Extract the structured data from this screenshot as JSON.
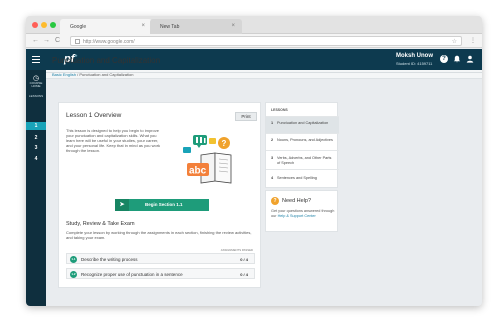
{
  "browser": {
    "tabs": [
      {
        "label": "Google",
        "close": "×"
      },
      {
        "label": "New Tab",
        "close": "×"
      }
    ],
    "url": "http://www.google.com/",
    "nav": {
      "back": "←",
      "forward": "→",
      "reload": "C"
    },
    "menu": "⋮"
  },
  "header": {
    "logo": "pf",
    "logo_sup": "+",
    "user_name": "Moksh Unow",
    "student_id": "Student ID: 4159711"
  },
  "rail": {
    "course_label": "COURSE HOME",
    "lessons_label": "LESSONS",
    "numbers": [
      "1",
      "2",
      "3",
      "4"
    ]
  },
  "breadcrumb": {
    "parent": "Basic English",
    "separator": "/",
    "current": "Punctuation and Capitalization"
  },
  "page": {
    "title": "Punctuation and Capitalization"
  },
  "card": {
    "title": "Lesson 1 Overview",
    "print_label": "Print",
    "description": "This lesson is designed to help you begin to improve your punctuation and capitalization skills. What you learn here will be useful in your studies, your career, and your personal life. Keep that in mind as you work through the lesson.",
    "illustration_text": "abc",
    "begin_label": "Begin Section 1.1",
    "study_title": "Study, Review & Take Exam",
    "study_desc": "Complete your lesson by working through the assignments in each section, finishing the review activities, and taking your exam.",
    "assign_header": "ASSIGNMENTS PASSED",
    "assignments": [
      {
        "num": "1.1",
        "text": "Describe the writing process",
        "score": "0 / 4"
      },
      {
        "num": "1.2",
        "text": "Recognize proper use of punctuation in a sentence",
        "score": "0 / 4"
      }
    ]
  },
  "lessons_panel": {
    "header": "LESSONS",
    "items": [
      {
        "num": "1",
        "text": "Punctuation and Capitalization"
      },
      {
        "num": "2",
        "text": "Nouns, Pronouns, and Adjectives"
      },
      {
        "num": "3",
        "text": "Verbs, Adverbs, and Other Parts of Speech"
      },
      {
        "num": "4",
        "text": "Sentences and Spelling"
      }
    ]
  },
  "help": {
    "icon": "?",
    "title": "Need Help?",
    "text": "Get your questions answered through our",
    "link": "Help & Support Center"
  },
  "colors": {
    "header_bg": "#0d3a4f",
    "accent_green": "#1e9c7a",
    "rail_bg": "#0f2f3e"
  }
}
